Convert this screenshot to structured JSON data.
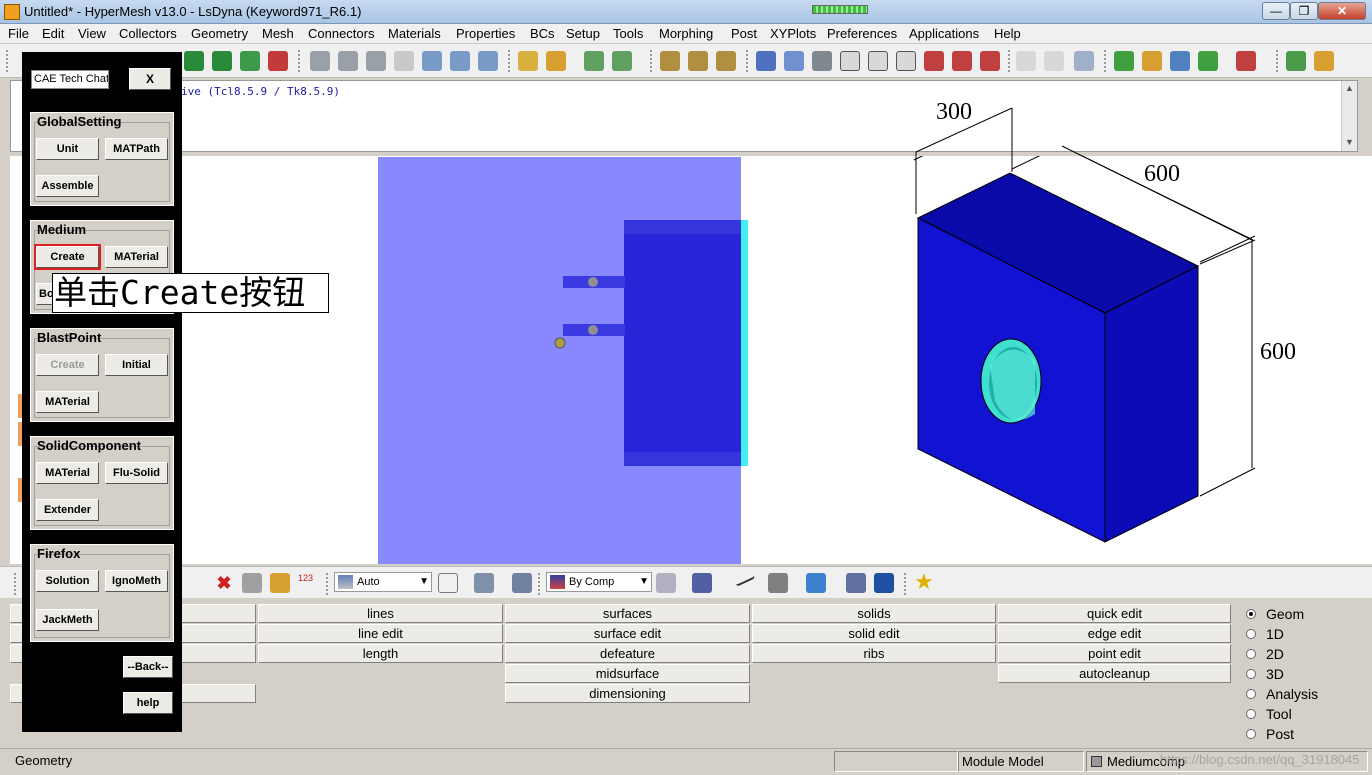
{
  "window": {
    "title": "Untitled* - HyperMesh v13.0 - LsDyna (Keyword971_R6.1)",
    "controls": {
      "min": "—",
      "max": "❐",
      "close": "✕"
    }
  },
  "menu": [
    "File",
    "Edit",
    "View",
    "Collectors",
    "Geometry",
    "Mesh",
    "Connectors",
    "Materials",
    "Properties",
    "BCs",
    "Setup",
    "Tools",
    "Morphing",
    "Post",
    "XYPlots",
    "Preferences",
    "Applications",
    "Help"
  ],
  "command_window": {
    "line1": "ive (Tcl8.5.9 / Tk8.5.9)",
    "scroll_up": "▲",
    "scroll_down": "▼"
  },
  "visual_toolbar": {
    "display_mode": "Auto",
    "color_mode": "By Comp"
  },
  "drawing": {
    "dim_top": "300",
    "dim_right_top": "600",
    "dim_right": "600",
    "colors": {
      "box_front": "#1212d2",
      "box_top": "#0a0aa8",
      "box_side": "#0b0bb8",
      "hole": "#40e0d0",
      "translucent": "#8888ff",
      "component": "#2626d8"
    }
  },
  "panel": {
    "columns": [
      [
        "",
        "",
        "",
        ""
      ],
      [
        "lines",
        "line edit",
        "length"
      ],
      [
        "surfaces",
        "surface edit",
        "defeature",
        "midsurface",
        "dimensioning"
      ],
      [
        "solids",
        "solid edit",
        "ribs"
      ],
      [
        "quick edit",
        "edge edit",
        "point edit",
        "autocleanup"
      ]
    ],
    "radio": [
      "Geom",
      "1D",
      "2D",
      "3D",
      "Analysis",
      "Tool",
      "Post"
    ],
    "radio_selected": "Geom"
  },
  "status": {
    "left": "Geometry",
    "module": "Module Model",
    "component": "Mediumcomp",
    "watermark": "https://blog.csdn.net/qq_31918045"
  },
  "plugin": {
    "chat_field": "CAE Tech Chat",
    "close": "X",
    "groups": {
      "global": {
        "title": "GlobalSetting",
        "unit": "Unit",
        "matpath": "MATPath",
        "assemble": "Assemble"
      },
      "medium": {
        "title": "Medium",
        "create": "Create",
        "material": "MATerial",
        "bo": "Bo"
      },
      "blast": {
        "title": "BlastPoint",
        "create": "Create",
        "initial": "Initial",
        "material": "MATerial"
      },
      "solid": {
        "title": "SolidComponent",
        "material": "MATerial",
        "flusolid": "Flu-Solid",
        "extender": "Extender"
      },
      "firefox": {
        "title": "Firefox",
        "solution": "Solution",
        "ignometh": "IgnoMeth",
        "jackmeth": "JackMeth"
      }
    },
    "back": "--Back--",
    "help": "help"
  },
  "annotation": "单击Create按钮"
}
